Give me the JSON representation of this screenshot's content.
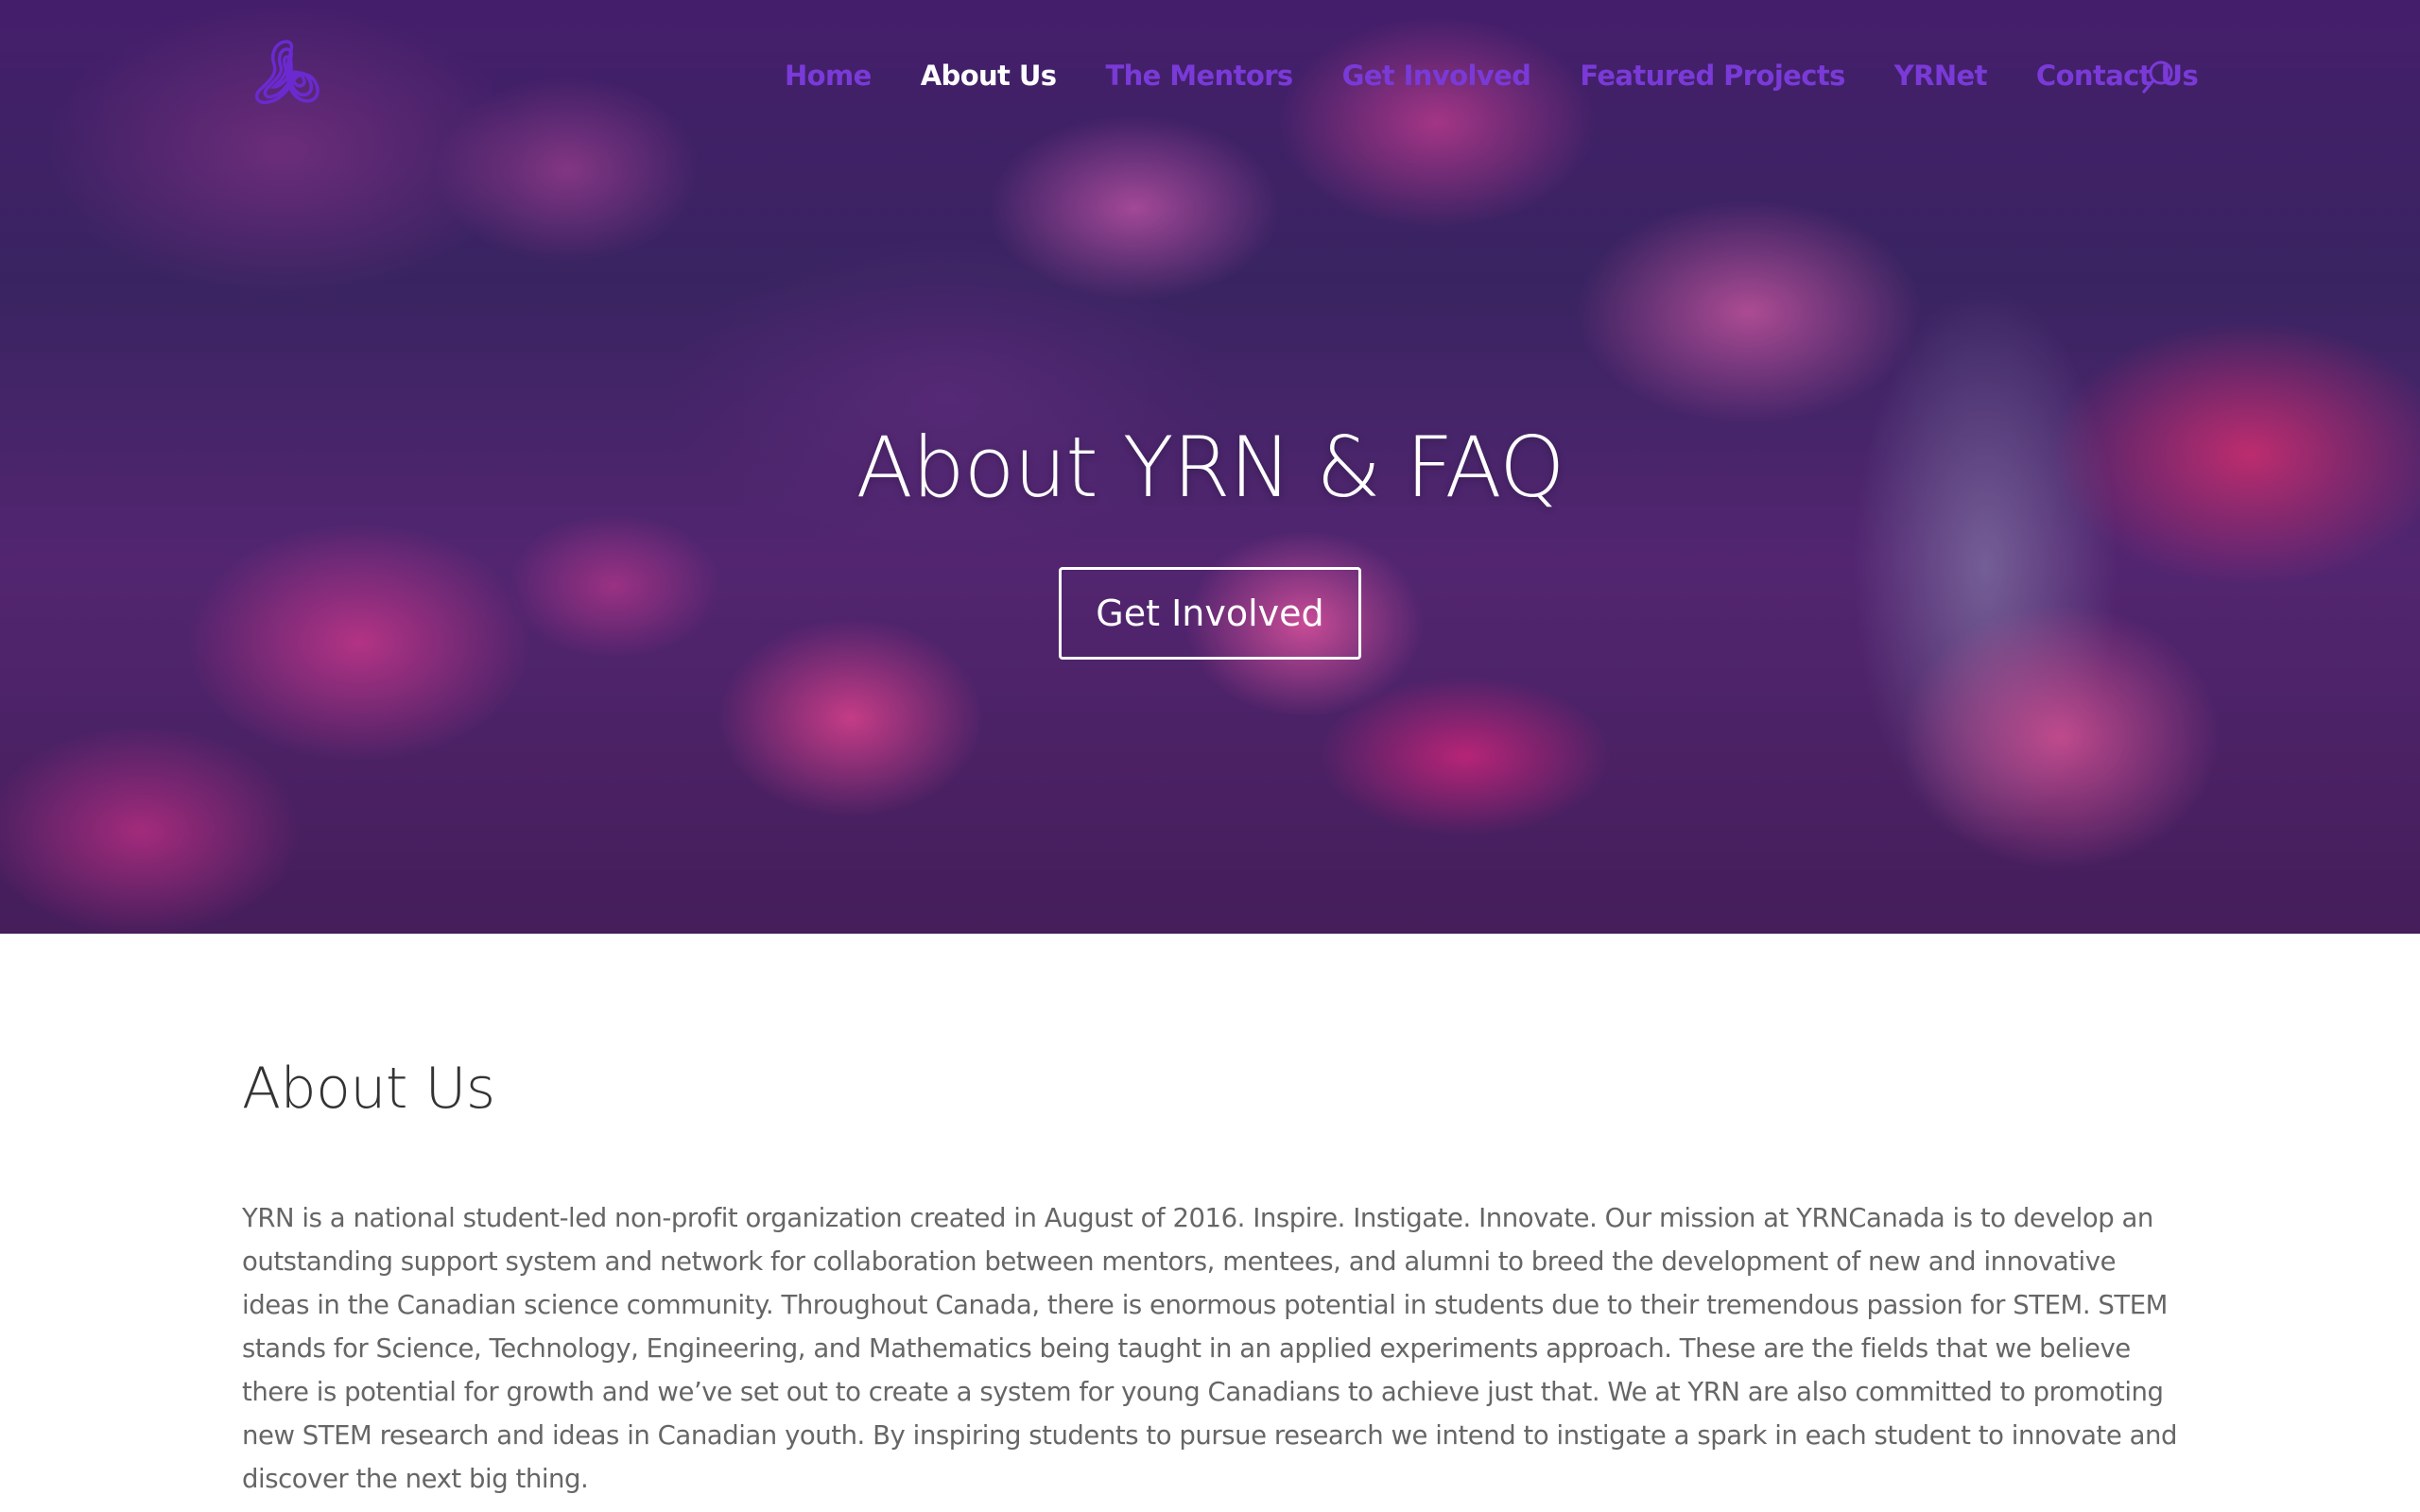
{
  "brand": {
    "logo_icon": "yrn-knot-logo-icon",
    "accent_color": "#7a3ad8"
  },
  "nav": {
    "items": [
      {
        "label": "Home",
        "active": false
      },
      {
        "label": "About Us",
        "active": true
      },
      {
        "label": "The Mentors",
        "active": false
      },
      {
        "label": "Get Involved",
        "active": false
      },
      {
        "label": "Featured Projects",
        "active": false
      },
      {
        "label": "YRNet",
        "active": false
      },
      {
        "label": "Contact Us",
        "active": false
      }
    ],
    "search_icon": "search-icon"
  },
  "hero": {
    "title": "About YRN & FAQ",
    "button_label": "Get Involved"
  },
  "about": {
    "heading": "About Us",
    "body": "YRN is a national student-led non-profit organization created in August of 2016. Inspire. Instigate. Innovate. Our mission at YRNCanada is to develop an outstanding support system and network for collaboration between mentors, mentees, and alumni to breed the development of new and innovative ideas in the Canadian science community. Throughout Canada, there is enormous potential in students due to their tremendous passion for STEM. STEM stands for Science, Technology, Engineering, and Mathematics being taught in an applied experiments approach. These are the fields that we believe there is potential for growth and we’ve set out to create a system for young Canadians to achieve just that. We at YRN are also committed to promoting new STEM research and ideas in Canadian youth. By inspiring students to pursue research we intend to instigate a spark in each student to innovate and discover the next big thing."
  }
}
